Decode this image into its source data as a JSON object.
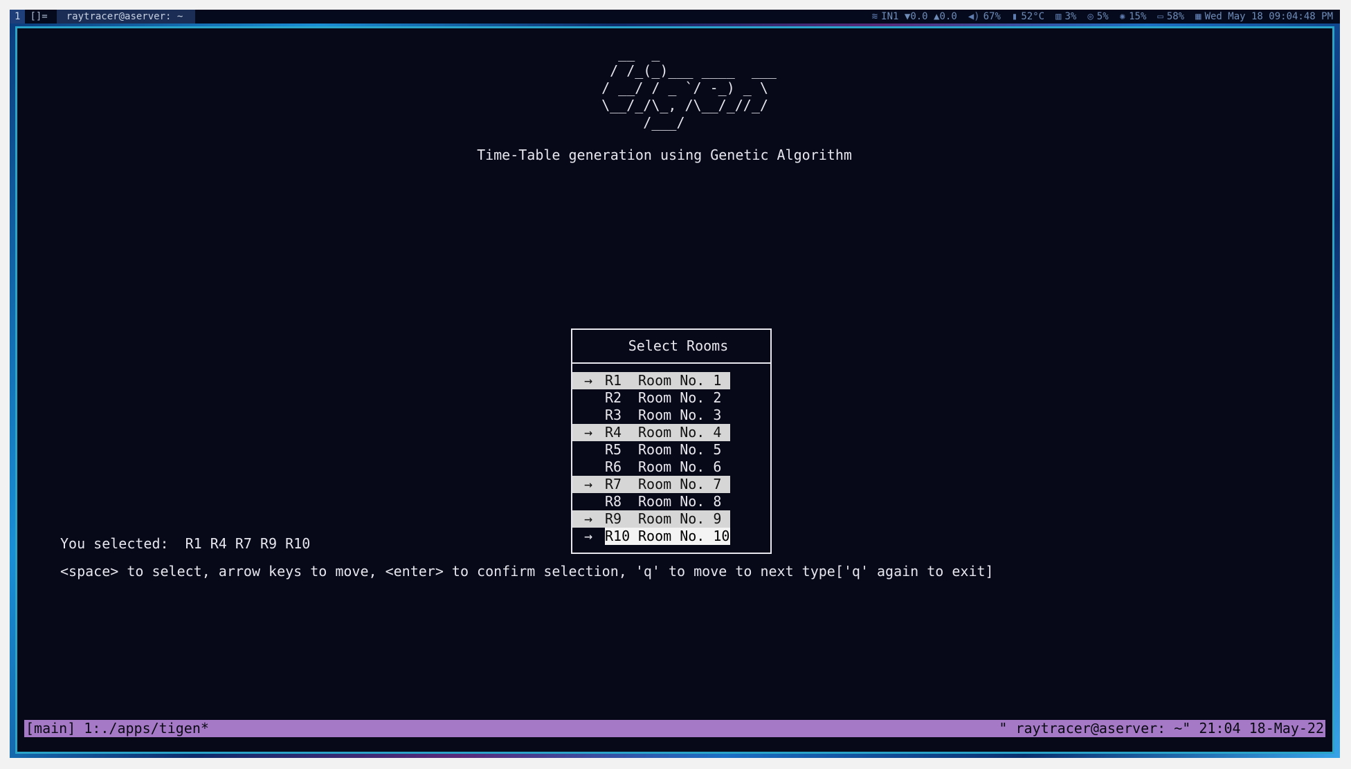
{
  "topbar": {
    "workspace": "1",
    "layout": "[]=",
    "window_title": "raytracer@aserver: ~",
    "status": [
      {
        "icon": "wifi-icon",
        "glyph": "≋",
        "text": "IN1 ▼0.0 ▲0.0"
      },
      {
        "icon": "volume-icon",
        "glyph": "◀)",
        "text": "67%"
      },
      {
        "icon": "thermometer-icon",
        "glyph": "▮",
        "text": "52°C"
      },
      {
        "icon": "memory-icon",
        "glyph": "▥",
        "text": "3%"
      },
      {
        "icon": "cpu-icon",
        "glyph": "◎",
        "text": "5%"
      },
      {
        "icon": "brightness-icon",
        "glyph": "✺",
        "text": "15%"
      },
      {
        "icon": "battery-icon",
        "glyph": "▭",
        "text": "58%"
      },
      {
        "icon": "calendar-icon",
        "glyph": "▦",
        "text": "Wed May 18 09:04:48 PM"
      }
    ]
  },
  "app": {
    "logo_ascii": "    __  _\n   / /_(_)___ ____  ___\n  / __/ / _ `/ -_) _ \\\n  \\__/_/\\_, /\\__/_//_/\n       /___/",
    "subtitle": "Time-Table generation using Genetic Algorithm",
    "dialog_title": "Select Rooms",
    "rooms": [
      {
        "code": "R1",
        "name": "Room No. 1",
        "selected": true,
        "cursor": false
      },
      {
        "code": "R2",
        "name": "Room No. 2",
        "selected": false,
        "cursor": false
      },
      {
        "code": "R3",
        "name": "Room No. 3",
        "selected": false,
        "cursor": false
      },
      {
        "code": "R4",
        "name": "Room No. 4",
        "selected": true,
        "cursor": false
      },
      {
        "code": "R5",
        "name": "Room No. 5",
        "selected": false,
        "cursor": false
      },
      {
        "code": "R6",
        "name": "Room No. 6",
        "selected": false,
        "cursor": false
      },
      {
        "code": "R7",
        "name": "Room No. 7",
        "selected": true,
        "cursor": false
      },
      {
        "code": "R8",
        "name": "Room No. 8",
        "selected": false,
        "cursor": false
      },
      {
        "code": "R9",
        "name": "Room No. 9",
        "selected": true,
        "cursor": false
      },
      {
        "code": "R10",
        "name": "Room No. 10",
        "selected": true,
        "cursor": true
      }
    ],
    "arrow_glyph": "→",
    "selected_label": "You selected:",
    "selected_values": "R1 R4 R7 R9 R10",
    "help_text": "<space> to select, arrow keys to move, <enter> to confirm selection, 'q' to move to next type['q' again to exit]"
  },
  "tmux": {
    "left": "[main] 1:./apps/tigen*",
    "right": "\" raytracer@aserver: ~\" 21:04 18-May-22"
  },
  "colors": {
    "terminal_bg": "#070818",
    "border_accent": "#2aa4c9",
    "tmux_bar": "#a579c6",
    "selection_bg": "#d6d6d6"
  }
}
